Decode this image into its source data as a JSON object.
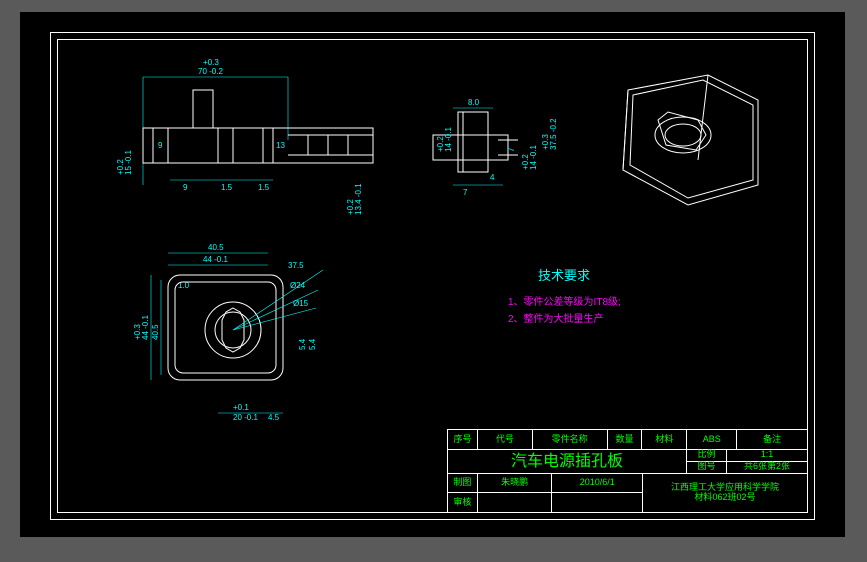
{
  "top_view": {
    "dim_width_tol": "+0.3",
    "dim_width": "70 -0.2",
    "dim_h1": "9",
    "dim_h2": "13",
    "dim_sp1": "9",
    "dim_sp2": "1.5",
    "dim_sp3": "1.5",
    "dim_left_tol": "+0.2",
    "dim_left": "15 -0.1",
    "dim_mid_tol": "+0.2",
    "dim_right": "13.4 -0.1"
  },
  "side_view": {
    "dim_top": "8.0",
    "dim_v": "14 -0.1",
    "dim_v_tol": "+0.2",
    "dim_r": "7",
    "dim_r2": "4",
    "dim_b": "7",
    "dim_left_tol": "+0.2",
    "dim_left": "14 -0.1",
    "dim_h": "37.5 -0.2",
    "dim_h_tol": "+0.3"
  },
  "front_view": {
    "dim_w": "40.5",
    "dim_w2": "44 -0.1",
    "dim_l": "1.0",
    "dim_a1": "37.5",
    "dim_d1": "Ø24",
    "dim_d2": "Ø15",
    "dim_h": "44 -0.1",
    "dim_h_tol": "+0.3",
    "dim_h2": "40.5",
    "dim_b": "20 -0.1",
    "dim_b_tol": "+0.1",
    "dim_b2": "4.5",
    "dim_s": "5.4",
    "dim_s2": "5.4"
  },
  "notes": {
    "title": "技术要求",
    "line1": "1、零件公差等级为IT8级;",
    "line2": "2、整件为大批量生产"
  },
  "title_block": {
    "hdr_no": "序号",
    "hdr_code": "代号",
    "hdr_name": "零件名称",
    "hdr_qty": "数量",
    "hdr_mat": "材料",
    "hdr_mat_v": "ABS",
    "hdr_note": "备注",
    "title": "汽车电源插孔板",
    "scale_l": "比例",
    "scale_v": "1:1",
    "sheet_l": "图号",
    "sheet_v": "共6张第2张",
    "drawn_l": "制图",
    "drawn_v": "朱晓鹏",
    "date": "2010/6/1",
    "check_l": "审核",
    "org1": "江西理工大学应用科学学院",
    "org2": "材料062班02号"
  }
}
